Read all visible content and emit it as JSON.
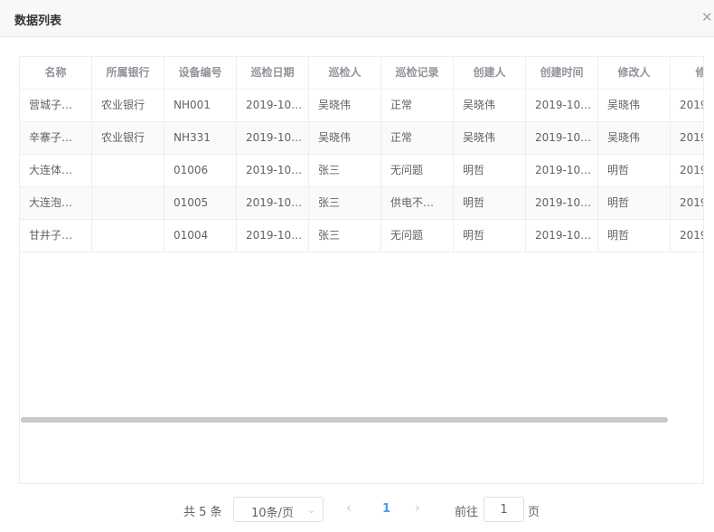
{
  "dialog": {
    "title": "数据列表",
    "close_icon": "close-icon"
  },
  "table": {
    "headers": [
      "名称",
      "所属银行",
      "设备编号",
      "巡检日期",
      "巡检人",
      "巡检记录",
      "创建人",
      "创建时间",
      "修改人",
      "修改"
    ],
    "rows": [
      [
        "营城子…",
        "农业银行",
        "NH001",
        "2019-10…",
        "吴晓伟",
        "正常",
        "吴晓伟",
        "2019-10…",
        "吴晓伟",
        "2019"
      ],
      [
        "辛寨子…",
        "农业银行",
        "NH331",
        "2019-10…",
        "吴晓伟",
        "正常",
        "吴晓伟",
        "2019-10…",
        "吴晓伟",
        "2019"
      ],
      [
        "大连体…",
        "",
        "01006",
        "2019-10…",
        "张三",
        "无问题",
        "明哲",
        "2019-10…",
        "明哲",
        "2019"
      ],
      [
        "大连泡…",
        "",
        "01005",
        "2019-10…",
        "张三",
        "供电不…",
        "明哲",
        "2019-10…",
        "明哲",
        "2019"
      ],
      [
        "甘井子…",
        "",
        "01004",
        "2019-10…",
        "张三",
        "无问题",
        "明哲",
        "2019-10…",
        "明哲",
        "2019"
      ]
    ]
  },
  "pagination": {
    "total": "共 5 条",
    "page_size": "10条/页",
    "current_page": "1",
    "goto_label": "前往",
    "goto_value": "1",
    "page_unit": "页",
    "prev_icon": "chevron-left-icon",
    "next_icon": "chevron-right-icon",
    "caret_icon": "chevron-down-icon"
  },
  "colors": {
    "accent": "#409eff",
    "header_bg": "#f8f8f8",
    "border": "#ebeef5"
  }
}
